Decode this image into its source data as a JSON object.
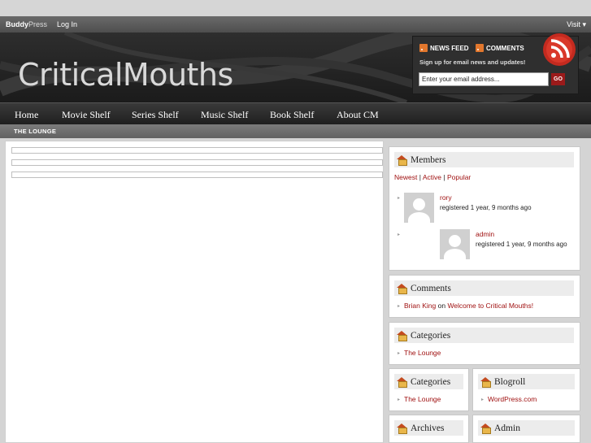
{
  "adminbar": {
    "brand_bold": "Buddy",
    "brand_light": "Press",
    "login": "Log In",
    "visit": "Visit"
  },
  "header": {
    "site_title": "CriticalMouths",
    "news_feed": "NEWS FEED",
    "comments": "COMMENTS",
    "signup": "Sign up for email news and updates!",
    "email_placeholder": "Enter your email address...",
    "go": "GO"
  },
  "nav": {
    "items": [
      {
        "label": "Home"
      },
      {
        "label": "Movie Shelf"
      },
      {
        "label": "Series Shelf"
      },
      {
        "label": "Music Shelf"
      },
      {
        "label": "Book Shelf"
      },
      {
        "label": "About CM"
      }
    ]
  },
  "breadcrumb": "THE LOUNGE",
  "sidebar": {
    "members": {
      "title": "Members",
      "filter_newest": "Newest",
      "sep1": "|",
      "filter_active": "Active",
      "sep2": "|",
      "filter_popular": "Popular",
      "list": [
        {
          "name": "rory",
          "registered": "registered 1 year, 9 months ago"
        },
        {
          "name": "admin",
          "registered": "registered 1 year, 9 months ago"
        }
      ]
    },
    "comments": {
      "title": "Comments",
      "author": "Brian King",
      "on": "on",
      "post": "Welcome to Critical Mouths!"
    },
    "categories": {
      "title": "Categories",
      "item": "The Lounge"
    },
    "categories2": {
      "title": "Categories",
      "item": "The Lounge"
    },
    "blogroll": {
      "title": "Blogroll",
      "item": "WordPress.com"
    },
    "archives": {
      "title": "Archives"
    },
    "admin": {
      "title": "Admin"
    }
  },
  "colors": {
    "link": "#a01212",
    "header_bg": "#232323",
    "nav_bg": "#2a2a2a",
    "accent_rss": "#e2772d"
  }
}
